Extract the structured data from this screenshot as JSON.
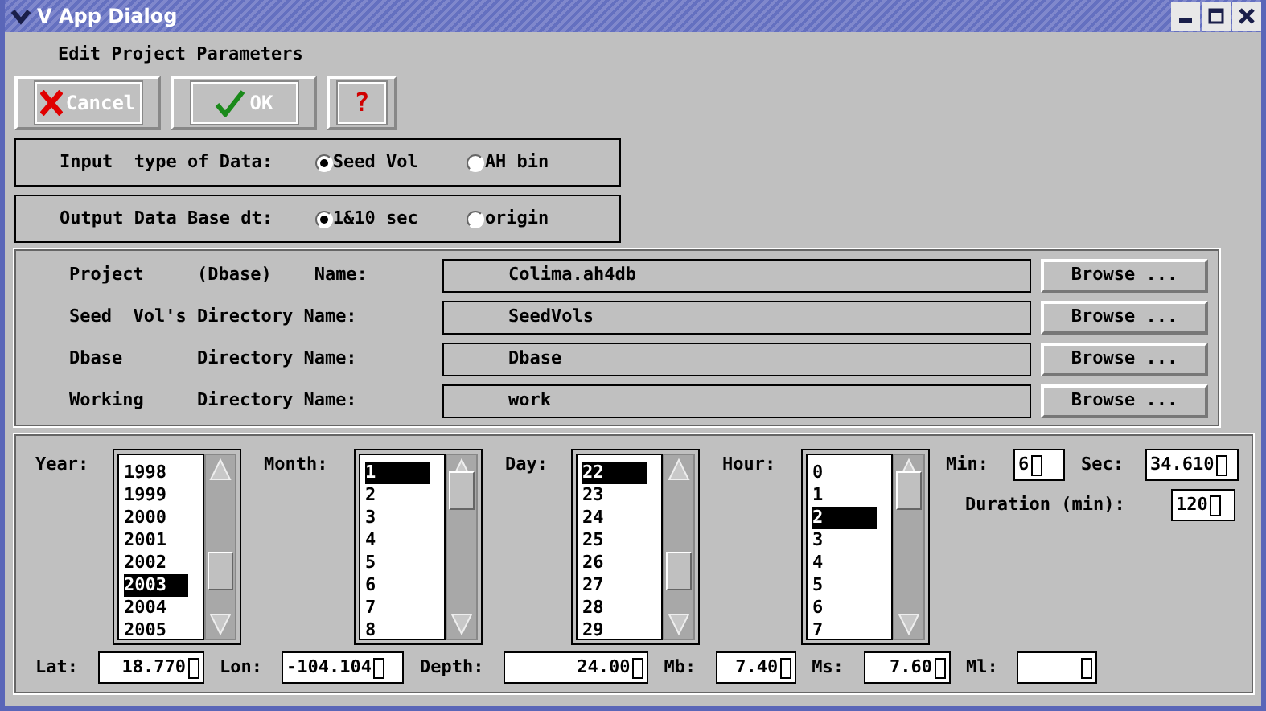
{
  "window": {
    "title": "V App Dialog"
  },
  "heading": "Edit Project Parameters",
  "buttons": [
    {
      "kind": "cancel",
      "label": "Cancel"
    },
    {
      "kind": "ok",
      "label": "OK"
    },
    {
      "kind": "help",
      "label": "?"
    }
  ],
  "radio_groups": [
    {
      "label": "Input  type of Data:",
      "options": [
        {
          "label": "Seed Vol",
          "selected": true
        },
        {
          "label": "AH bin",
          "selected": false
        }
      ]
    },
    {
      "label": "Output Data Base dt:",
      "options": [
        {
          "label": "1&10 sec",
          "selected": true
        },
        {
          "label": "origin",
          "selected": false
        }
      ]
    }
  ],
  "paths": [
    {
      "label": "Project     (Dbase)    Name:",
      "value": "Colima.ah4db",
      "button": "Browse ..."
    },
    {
      "label": "Seed  Vol's Directory Name:",
      "value": "SeedVols",
      "button": "Browse ..."
    },
    {
      "label": "Dbase       Directory Name:",
      "value": "Dbase",
      "button": "Browse ..."
    },
    {
      "label": "Working     Directory Name:",
      "value": "work",
      "button": "Browse ..."
    }
  ],
  "lists": [
    {
      "label": "Year:",
      "items": [
        {
          "text": "1998",
          "selected": false
        },
        {
          "text": "1999",
          "selected": false
        },
        {
          "text": "2000",
          "selected": false
        },
        {
          "text": "2001",
          "selected": false
        },
        {
          "text": "2002",
          "selected": false
        },
        {
          "text": "2003",
          "selected": true
        },
        {
          "text": "2004",
          "selected": false
        },
        {
          "text": "2005",
          "selected": false
        }
      ]
    },
    {
      "label": "Month:",
      "items": [
        {
          "text": "1",
          "selected": true
        },
        {
          "text": "2",
          "selected": false
        },
        {
          "text": "3",
          "selected": false
        },
        {
          "text": "4",
          "selected": false
        },
        {
          "text": "5",
          "selected": false
        },
        {
          "text": "6",
          "selected": false
        },
        {
          "text": "7",
          "selected": false
        },
        {
          "text": "8",
          "selected": false
        }
      ]
    },
    {
      "label": "Day:",
      "items": [
        {
          "text": "22",
          "selected": true
        },
        {
          "text": "23",
          "selected": false
        },
        {
          "text": "24",
          "selected": false
        },
        {
          "text": "25",
          "selected": false
        },
        {
          "text": "26",
          "selected": false
        },
        {
          "text": "27",
          "selected": false
        },
        {
          "text": "28",
          "selected": false
        },
        {
          "text": "29",
          "selected": false
        }
      ]
    },
    {
      "label": "Hour:",
      "items": [
        {
          "text": "0",
          "selected": false
        },
        {
          "text": "1",
          "selected": false
        },
        {
          "text": "2",
          "selected": true
        },
        {
          "text": "3",
          "selected": false
        },
        {
          "text": "4",
          "selected": false
        },
        {
          "text": "5",
          "selected": false
        },
        {
          "text": "6",
          "selected": false
        },
        {
          "text": "7",
          "selected": false
        }
      ]
    }
  ],
  "time_fields": [
    {
      "label": "Min:",
      "value": "6"
    },
    {
      "label": "Sec:",
      "value": "34.610"
    }
  ],
  "duration": {
    "label": "Duration (min):",
    "value": "120"
  },
  "bottom_fields": [
    {
      "label": "Lat:",
      "value": "18.770"
    },
    {
      "label": "Lon:",
      "value": "-104.104"
    },
    {
      "label": "Depth:",
      "value": "24.00"
    },
    {
      "label": "Mb:",
      "value": "7.40"
    },
    {
      "label": "Ms:",
      "value": "7.60"
    },
    {
      "label": "Ml:"
    }
  ]
}
